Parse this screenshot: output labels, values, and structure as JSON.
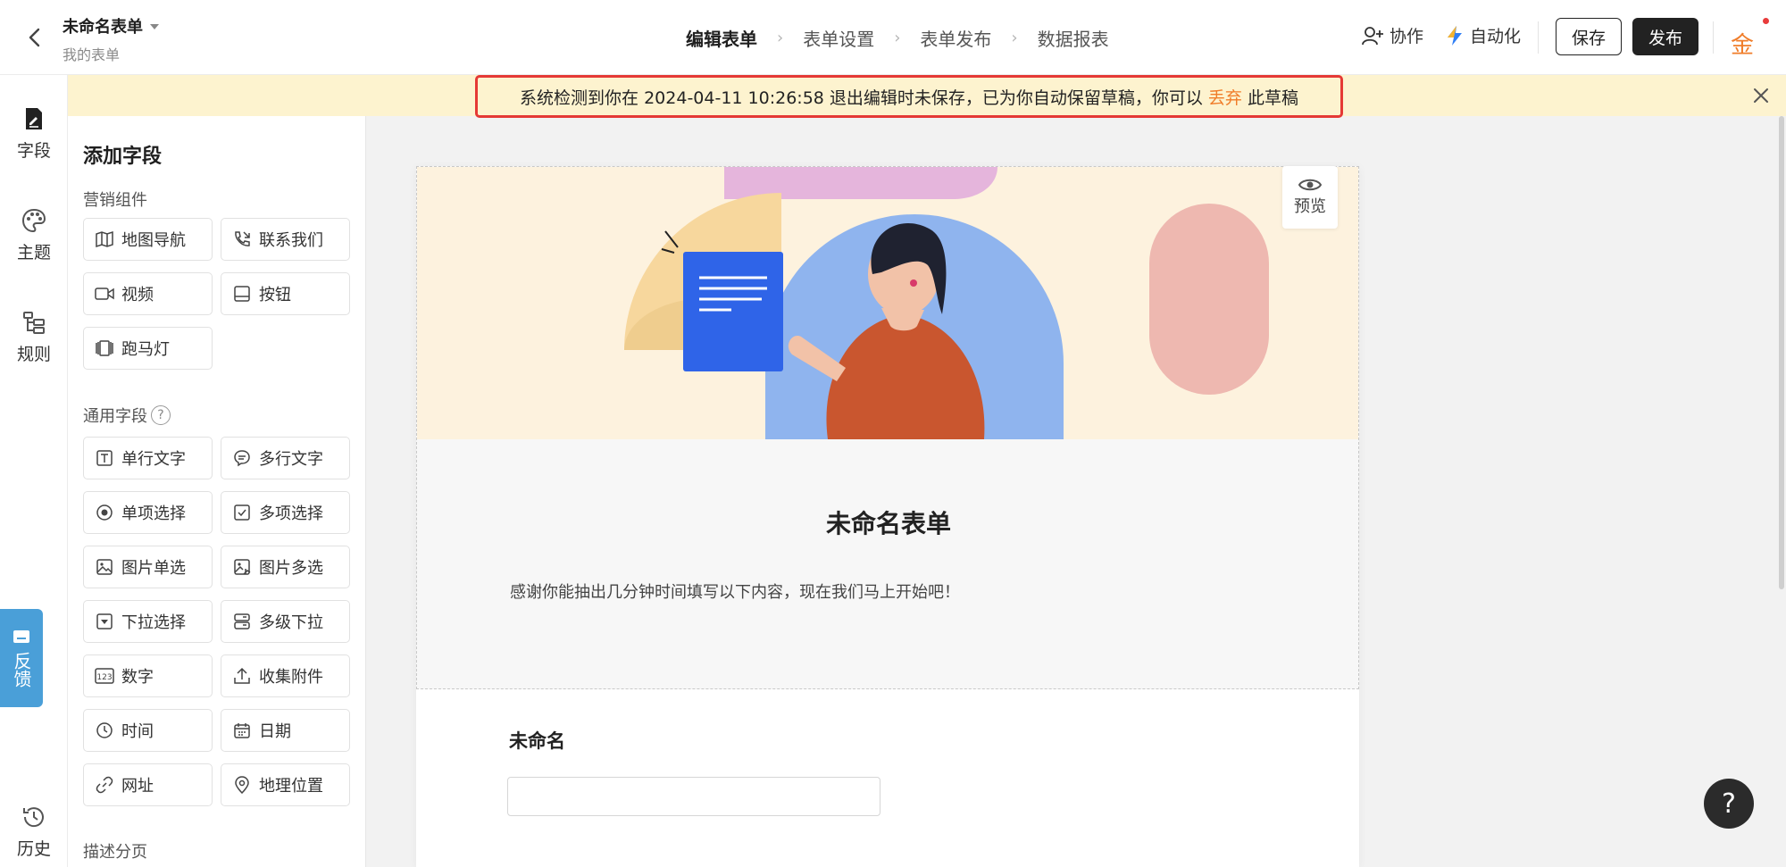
{
  "header": {
    "title": "未命名表单",
    "subtitle": "我的表单",
    "steps": [
      "编辑表单",
      "表单设置",
      "表单发布",
      "数据报表"
    ],
    "collab_label": "协作",
    "automation_label": "自动化",
    "save_label": "保存",
    "publish_label": "发布",
    "coin_label": "金",
    "accent_color": "#f07d2a"
  },
  "notice": {
    "text_before": "系统检测到你在 2024-04-11 10:26:58 退出编辑时未保存，已为你自动保留草稿，你可以",
    "discard_label": "丢弃",
    "text_after": "此草稿"
  },
  "rail": {
    "items": [
      {
        "label": "字段",
        "icon": "field-icon"
      },
      {
        "label": "主题",
        "icon": "palette-icon"
      },
      {
        "label": "规则",
        "icon": "rules-icon"
      },
      {
        "label": "历史",
        "icon": "history-icon"
      }
    ],
    "feedback_label": "反馈"
  },
  "panel": {
    "title": "添加字段",
    "sections": [
      {
        "title": "营销组件",
        "items": [
          {
            "label": "地图导航",
            "icon": "map-icon"
          },
          {
            "label": "联系我们",
            "icon": "phone-icon"
          },
          {
            "label": "视频",
            "icon": "video-icon"
          },
          {
            "label": "按钮",
            "icon": "button-icon"
          },
          {
            "label": "跑马灯",
            "icon": "marquee-icon"
          }
        ]
      },
      {
        "title": "通用字段",
        "items": [
          {
            "label": "单行文字",
            "icon": "text-icon"
          },
          {
            "label": "多行文字",
            "icon": "multiline-icon"
          },
          {
            "label": "单项选择",
            "icon": "radio-icon"
          },
          {
            "label": "多项选择",
            "icon": "checkbox-icon"
          },
          {
            "label": "图片单选",
            "icon": "image-icon"
          },
          {
            "label": "图片多选",
            "icon": "images-icon"
          },
          {
            "label": "下拉选择",
            "icon": "dropdown-icon"
          },
          {
            "label": "多级下拉",
            "icon": "cascade-icon"
          },
          {
            "label": "数字",
            "icon": "number-icon"
          },
          {
            "label": "收集附件",
            "icon": "upload-icon"
          },
          {
            "label": "时间",
            "icon": "clock-icon"
          },
          {
            "label": "日期",
            "icon": "calendar-icon"
          },
          {
            "label": "网址",
            "icon": "link-icon"
          },
          {
            "label": "地理位置",
            "icon": "location-icon"
          }
        ]
      },
      {
        "title": "描述分页",
        "items": []
      }
    ]
  },
  "canvas": {
    "preview_label": "预览",
    "form_title": "未命名表单",
    "form_desc": "感谢你能抽出几分钟时间填写以下内容，现在我们马上开始吧！",
    "question_label": "未命名",
    "question_value": ""
  },
  "help_label": "?"
}
